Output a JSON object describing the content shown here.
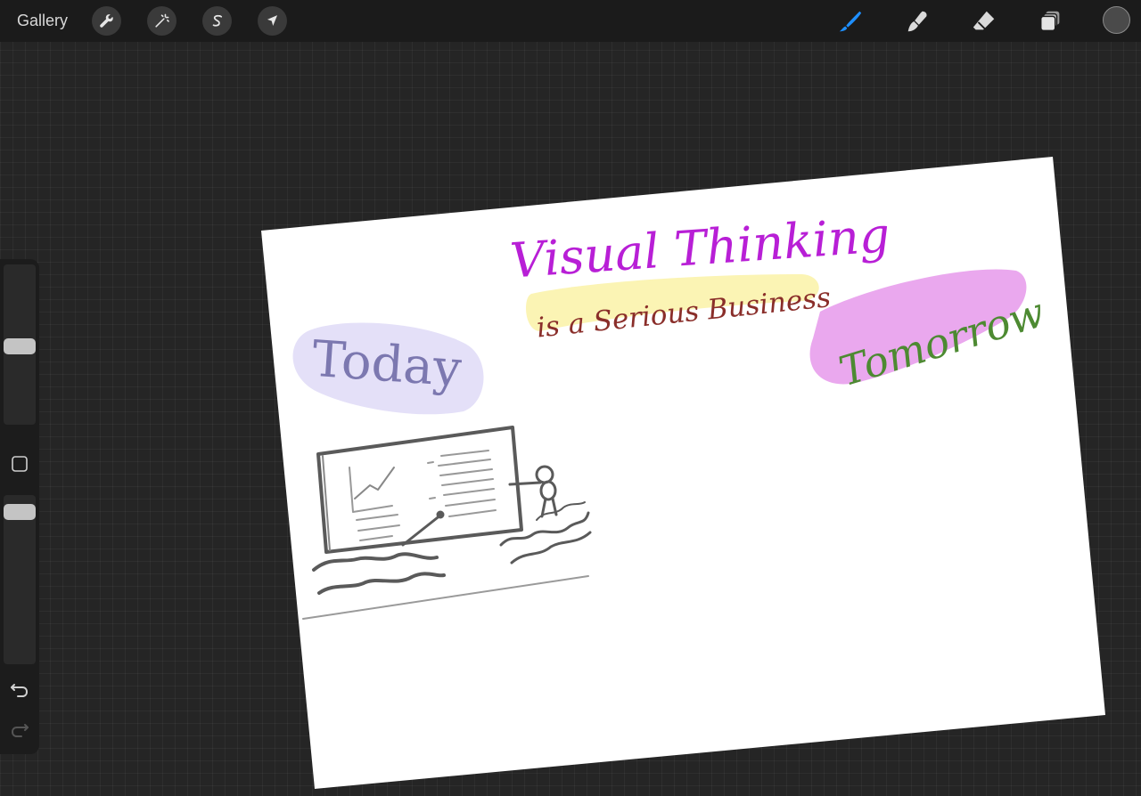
{
  "toolbar": {
    "gallery_label": "Gallery",
    "left_tools": [
      {
        "name": "actions",
        "icon": "wrench-icon"
      },
      {
        "name": "adjustments",
        "icon": "magic-wand-icon"
      },
      {
        "name": "selection",
        "icon": "selection-s-icon"
      },
      {
        "name": "transform",
        "icon": "arrow-cursor-icon"
      }
    ],
    "right_tools": [
      {
        "name": "brush",
        "icon": "brush-icon",
        "active": true
      },
      {
        "name": "smudge",
        "icon": "smudge-icon"
      },
      {
        "name": "eraser",
        "icon": "eraser-icon"
      },
      {
        "name": "layers",
        "icon": "layers-icon"
      }
    ],
    "accent_color": "#1e8fff",
    "current_color": "#4a4a4a"
  },
  "sidebar": {
    "brush_size_level": 0.52,
    "opacity_level": 0.87,
    "undo_icon": "undo-icon",
    "redo_icon": "redo-icon",
    "modify_icon": "square-icon"
  },
  "canvas": {
    "title_line1": "Visual Thinking",
    "title_line2": "is a Serious Business",
    "label_left": "Today",
    "label_right": "Tomorrow",
    "colors": {
      "title": "#b81fd6",
      "subtitle": "#8a2e2a",
      "subtitle_highlight": "#fbf3b0",
      "today_text": "#7c78b0",
      "today_highlight": "#e4e0f8",
      "tomorrow_text": "#4d8a32",
      "tomorrow_highlight": "#eaa8ee",
      "sketch": "#5a5a5a"
    }
  }
}
